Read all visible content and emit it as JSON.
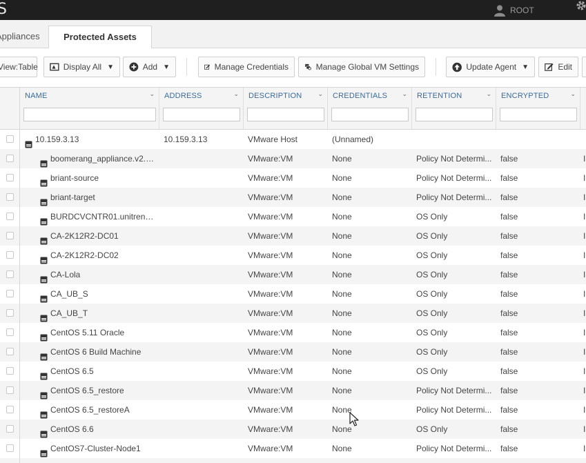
{
  "topbar": {
    "logo": "S",
    "user": "ROOT"
  },
  "tabs": [
    {
      "label": "Appliances"
    },
    {
      "label": "Protected Assets"
    }
  ],
  "toolbar": {
    "view": "View:Table",
    "display_all": "Display All",
    "add": "Add",
    "manage_credentials": "Manage Credentials",
    "manage_global": "Manage Global VM Settings",
    "update_agent": "Update Agent",
    "edit": "Edit",
    "caret": "▼"
  },
  "columns": [
    {
      "label": "NAME"
    },
    {
      "label": "ADDRESS"
    },
    {
      "label": "DESCRIPTION"
    },
    {
      "label": "CREDENTIALS"
    },
    {
      "label": "RETENTION"
    },
    {
      "label": "ENCRYPTED"
    }
  ],
  "rows": [
    {
      "name": "10.159.3.13",
      "address": "10.159.3.13",
      "description": "VMware Host",
      "credentials": "(Unnamed)",
      "retention": "",
      "encrypted": "",
      "last": "",
      "child": false
    },
    {
      "name": "boomerang_appliance.v2.2....",
      "address": "",
      "description": "VMware:VM",
      "credentials": "None",
      "retention": "Policy Not Determi...",
      "encrypted": "false",
      "last": "I",
      "child": true
    },
    {
      "name": "briant-source",
      "address": "",
      "description": "VMware:VM",
      "credentials": "None",
      "retention": "Policy Not Determi...",
      "encrypted": "false",
      "last": "I",
      "child": true
    },
    {
      "name": "briant-target",
      "address": "",
      "description": "VMware:VM",
      "credentials": "None",
      "retention": "Policy Not Determi...",
      "encrypted": "false",
      "last": "I",
      "child": true
    },
    {
      "name": "BURDCVCNTR01.unitrends....",
      "address": "",
      "description": "VMware:VM",
      "credentials": "None",
      "retention": "OS Only",
      "encrypted": "false",
      "last": "I",
      "child": true
    },
    {
      "name": "CA-2K12R2-DC01",
      "address": "",
      "description": "VMware:VM",
      "credentials": "None",
      "retention": "OS Only",
      "encrypted": "false",
      "last": "I",
      "child": true
    },
    {
      "name": "CA-2K12R2-DC02",
      "address": "",
      "description": "VMware:VM",
      "credentials": "None",
      "retention": "OS Only",
      "encrypted": "false",
      "last": "I",
      "child": true
    },
    {
      "name": "CA-Lola",
      "address": "",
      "description": "VMware:VM",
      "credentials": "None",
      "retention": "OS Only",
      "encrypted": "false",
      "last": "I",
      "child": true
    },
    {
      "name": "CA_UB_S",
      "address": "",
      "description": "VMware:VM",
      "credentials": "None",
      "retention": "OS Only",
      "encrypted": "false",
      "last": "I",
      "child": true
    },
    {
      "name": "CA_UB_T",
      "address": "",
      "description": "VMware:VM",
      "credentials": "None",
      "retention": "OS Only",
      "encrypted": "false",
      "last": "I",
      "child": true
    },
    {
      "name": "CentOS 5.11 Oracle",
      "address": "",
      "description": "VMware:VM",
      "credentials": "None",
      "retention": "OS Only",
      "encrypted": "false",
      "last": "I",
      "child": true
    },
    {
      "name": "CentOS 6 Build Machine",
      "address": "",
      "description": "VMware:VM",
      "credentials": "None",
      "retention": "OS Only",
      "encrypted": "false",
      "last": "I",
      "child": true
    },
    {
      "name": "CentOS 6.5",
      "address": "",
      "description": "VMware:VM",
      "credentials": "None",
      "retention": "OS Only",
      "encrypted": "false",
      "last": "I",
      "child": true
    },
    {
      "name": "CentOS 6.5_restore",
      "address": "",
      "description": "VMware:VM",
      "credentials": "None",
      "retention": "Policy Not Determi...",
      "encrypted": "false",
      "last": "I",
      "child": true
    },
    {
      "name": "CentOS 6.5_restoreA",
      "address": "",
      "description": "VMware:VM",
      "credentials": "None",
      "retention": "Policy Not Determi...",
      "encrypted": "false",
      "last": "I",
      "child": true
    },
    {
      "name": "CentOS 6.6",
      "address": "",
      "description": "VMware:VM",
      "credentials": "None",
      "retention": "OS Only",
      "encrypted": "false",
      "last": "I",
      "child": true
    },
    {
      "name": "CentOS7-Cluster-Node1",
      "address": "",
      "description": "VMware:VM",
      "credentials": "None",
      "retention": "Policy Not Determi...",
      "encrypted": "false",
      "last": "I",
      "child": true
    },
    {
      "name": "",
      "address": "",
      "description": "",
      "credentials": "",
      "retention": "",
      "encrypted": "",
      "last": "",
      "child": true
    }
  ]
}
